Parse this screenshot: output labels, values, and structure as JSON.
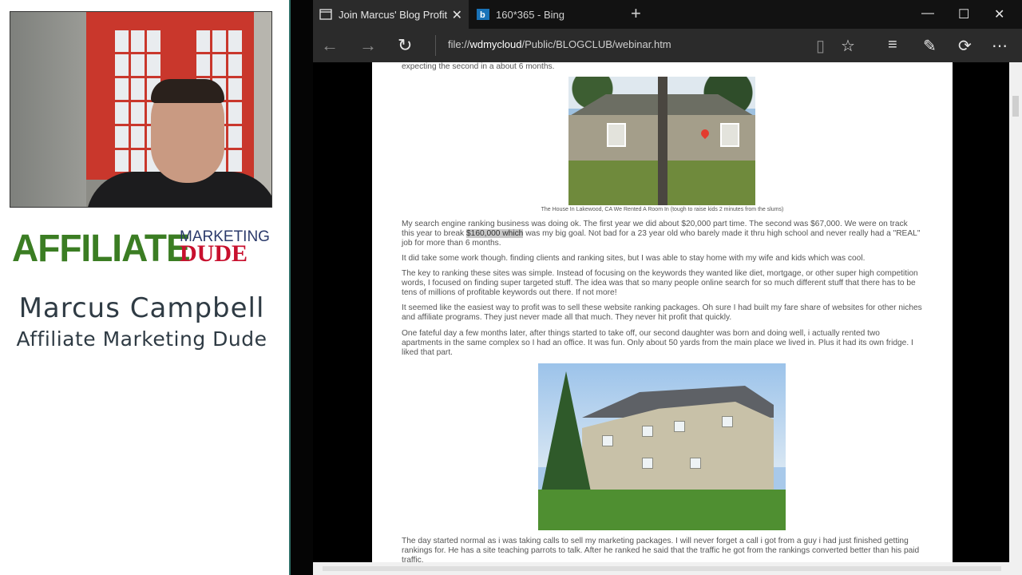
{
  "presenter": {
    "name": "Marcus Campbell",
    "title": "Affiliate Marketing Dude",
    "logo_main": "AFFILIATE",
    "logo_top": "MARKETING",
    "logo_bottom": "DUDE"
  },
  "browser": {
    "tabs": [
      {
        "label": "Join Marcus' Blog Profit",
        "active": true
      },
      {
        "label": "160*365 - Bing",
        "active": false
      }
    ],
    "address": {
      "prefix": "file://",
      "host": "wdmycloud",
      "path": "/Public/BLOGCLUB/webinar.htm"
    },
    "icons": [
      "back-icon",
      "forward-icon",
      "refresh-icon",
      "reading-view-icon",
      "favorite-star-icon",
      "hub-icon",
      "web-note-icon",
      "share-icon",
      "more-icon"
    ]
  },
  "page": {
    "top_line": "expecting the second in a about 6 months.",
    "house_caption": "The House In Lakewood, CA We Rented A Room In (tough to raise kids 2 minutes from the slums)",
    "p1_before": "My search engine ranking business was doing ok. The first year we did about $20,000 part time. The second was $67,000. We were on track this year to break ",
    "p1_highlight": "$160,000 which",
    "p1_after": " was my big goal. Not bad for a 23 year old who barely made it thru high school and never really had a \"REAL\" job for more than 6 months.",
    "p2": "It did take some work though. finding clients and ranking sites, but I was able to stay home with my wife and kids which was cool.",
    "p3": "The key to ranking these sites was simple. Instead of focusing on the keywords they wanted like diet, mortgage, or other super high competition words, I focused on finding super targeted stuff. The idea was that so many people online search for so much different stuff that there has to be tens of millions of profitable keywords out there. If not more!",
    "p4": "It seemed like the easiest way to profit was to sell these website ranking packages. Oh sure I had built my fare share of websites for other niches and affiliate programs. They just never made all that much. They never hit profit that quickly.",
    "p5": "One fateful day a few months later, after things started to take off, our second daughter was born and doing well, i actually rented two apartments in the same complex so I had an office. It was fun. Only about 50 yards from the main place we lived in. Plus it had its own fridge. I liked that part.",
    "p6": "The day started normal as i was taking calls to sell my marketing packages. I will never forget a call i got from a guy i had just finished getting rankings for. He has a site teaching parrots to talk. After he ranked he said that the traffic he got from the rankings converted better than his paid traffic."
  }
}
